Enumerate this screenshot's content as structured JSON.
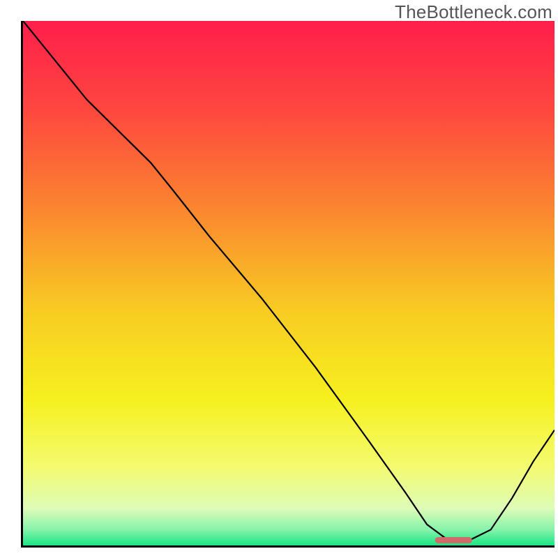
{
  "watermark": "TheBottleneck.com",
  "chart_data": {
    "type": "line",
    "title": "",
    "xlabel": "",
    "ylabel": "",
    "xlim": [
      0,
      100
    ],
    "ylim": [
      0,
      100
    ],
    "series": [
      {
        "name": "curve",
        "x": [
          0,
          8,
          12,
          18,
          24,
          28,
          35,
          45,
          55,
          65,
          72,
          76,
          80,
          84,
          88,
          92,
          96,
          100
        ],
        "y": [
          100,
          90,
          85,
          79,
          73,
          68,
          59,
          47,
          34,
          20,
          10,
          4,
          1,
          1,
          3,
          9,
          16,
          22
        ]
      }
    ],
    "marker": {
      "x": 81,
      "y": 1,
      "width": 7,
      "height": 1.2,
      "color": "#D16A6A"
    },
    "gradient_stops": [
      {
        "offset": 0,
        "color": "#FF1E4B"
      },
      {
        "offset": 18,
        "color": "#FE4A3E"
      },
      {
        "offset": 35,
        "color": "#FB8330"
      },
      {
        "offset": 55,
        "color": "#F8CB23"
      },
      {
        "offset": 72,
        "color": "#F6F01E"
      },
      {
        "offset": 85,
        "color": "#F4FB6F"
      },
      {
        "offset": 93,
        "color": "#DDFCB7"
      },
      {
        "offset": 97,
        "color": "#86F3AB"
      },
      {
        "offset": 100,
        "color": "#19E584"
      }
    ]
  }
}
